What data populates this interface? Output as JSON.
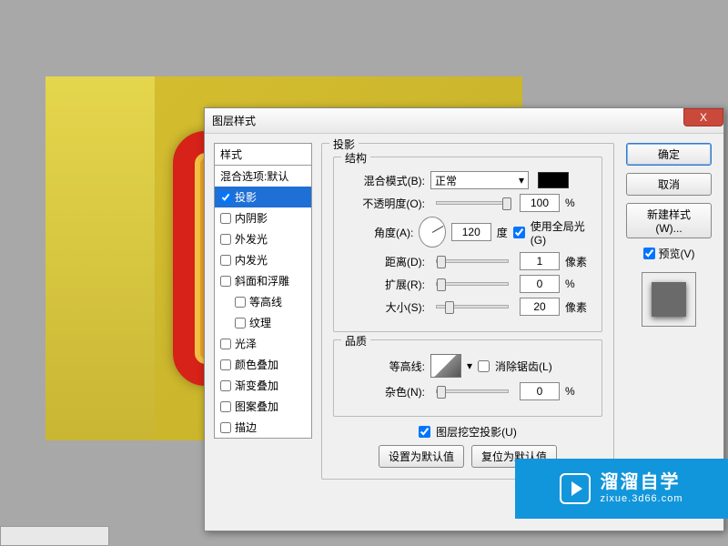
{
  "dialog": {
    "title": "图层样式",
    "close_x": "X"
  },
  "style_list": {
    "header": "样式",
    "items": [
      {
        "label": "混合选项:默认",
        "type": "group"
      },
      {
        "label": "投影",
        "checked": true,
        "selected": true
      },
      {
        "label": "内阴影",
        "checked": false
      },
      {
        "label": "外发光",
        "checked": false
      },
      {
        "label": "内发光",
        "checked": false
      },
      {
        "label": "斜面和浮雕",
        "checked": false
      },
      {
        "label": "等高线",
        "checked": false,
        "indent": true
      },
      {
        "label": "纹理",
        "checked": false,
        "indent": true
      },
      {
        "label": "光泽",
        "checked": false
      },
      {
        "label": "颜色叠加",
        "checked": false
      },
      {
        "label": "渐变叠加",
        "checked": false
      },
      {
        "label": "图案叠加",
        "checked": false
      },
      {
        "label": "描边",
        "checked": false
      }
    ]
  },
  "panel": {
    "section_title": "投影",
    "structure_title": "结构",
    "blend_label": "混合模式(B):",
    "blend_value": "正常",
    "opacity_label": "不透明度(O):",
    "opacity_value": "100",
    "percent": "%",
    "angle_label": "角度(A):",
    "angle_value": "120",
    "degree": "度",
    "global_light": "使用全局光(G)",
    "distance_label": "距离(D):",
    "distance_value": "1",
    "px": "像素",
    "spread_label": "扩展(R):",
    "spread_value": "0",
    "size_label": "大小(S):",
    "size_value": "20",
    "quality_title": "品质",
    "contour_label": "等高线:",
    "antialias": "消除锯齿(L)",
    "noise_label": "杂色(N):",
    "noise_value": "0",
    "knockout": "图层挖空投影(U)",
    "set_default": "设置为默认值",
    "reset_default": "复位为默认值"
  },
  "buttons": {
    "ok": "确定",
    "cancel": "取消",
    "new_style": "新建样式(W)...",
    "preview": "预览(V)"
  },
  "watermark": {
    "brand": "溜溜自学",
    "url": "zixue.3d66.com"
  }
}
